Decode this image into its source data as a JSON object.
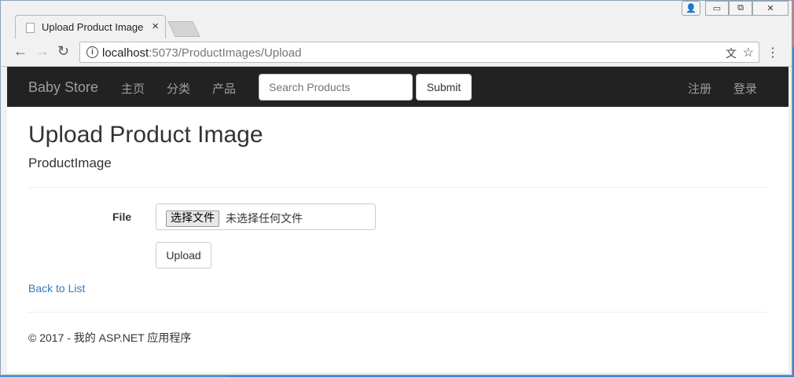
{
  "browser": {
    "tab_title": "Upload Product Image",
    "tab_close": "×",
    "back": "←",
    "forward": "→",
    "reload": "↻",
    "info": "i",
    "url_host": "localhost",
    "url_path": ":5073/ProductImages/Upload",
    "translate_icon": "文",
    "star_icon": "☆",
    "menu_icon": "⋮",
    "win_user": "👤",
    "win_min": "▭",
    "win_max": "⧉",
    "win_close": "✕"
  },
  "nav": {
    "brand": "Baby Store",
    "links": [
      "主页",
      "分类",
      "产品"
    ],
    "search_placeholder": "Search Products",
    "submit": "Submit",
    "register": "注册",
    "login": "登录"
  },
  "main": {
    "title": "Upload Product Image",
    "subtitle": "ProductImage",
    "file_label": "File",
    "choose_file": "选择文件",
    "no_file": "未选择任何文件",
    "upload_button": "Upload",
    "back_link": "Back to List"
  },
  "footer": {
    "text": "© 2017 - 我的 ASP.NET 应用程序"
  },
  "colors": {
    "navbar": "#222222",
    "link": "#337ab7",
    "desktop": "#3d86cf"
  }
}
